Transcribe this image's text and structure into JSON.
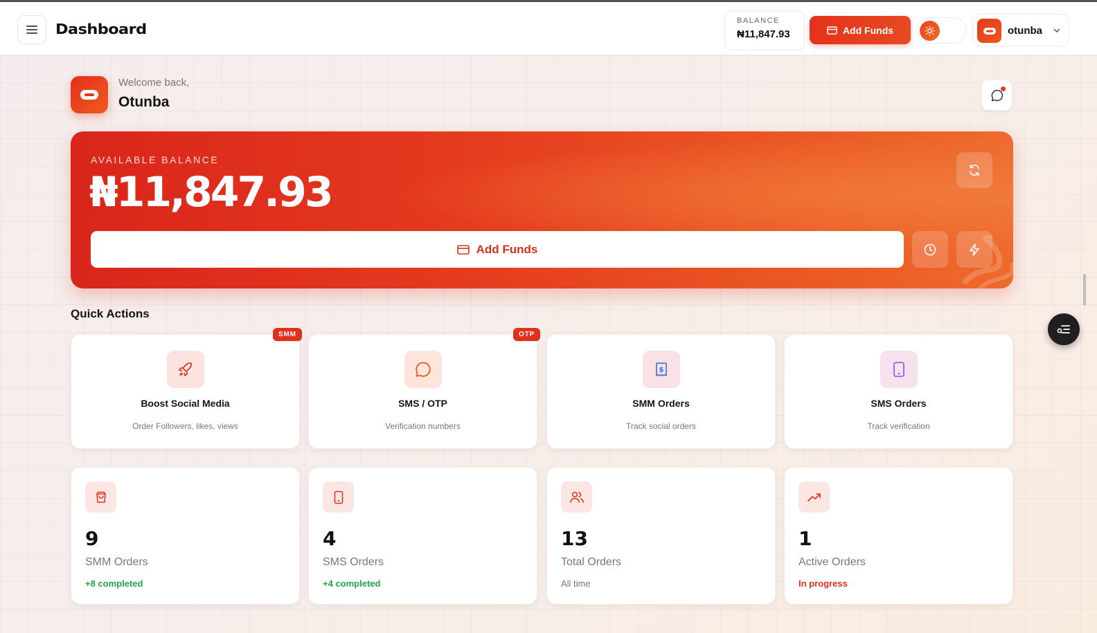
{
  "header": {
    "title": "Dashboard",
    "balance_label": "BALANCE",
    "balance_value": "₦11,847.93",
    "add_funds_label": "Add Funds",
    "username": "otunba"
  },
  "greeting": {
    "subtitle": "Welcome back,",
    "name": "Otunba"
  },
  "balance_card": {
    "label": "AVAILABLE BALANCE",
    "amount": "₦11,847.93",
    "add_funds_label": "Add Funds"
  },
  "quick_actions": {
    "title": "Quick Actions",
    "items": [
      {
        "title": "Boost Social Media",
        "subtitle": "Order Followers, likes, views",
        "badge": "SMM",
        "icon": "rocket-icon",
        "accent": "#e0301b"
      },
      {
        "title": "SMS / OTP",
        "subtitle": "Verification numbers",
        "badge": "OTP",
        "icon": "chat-bubble-icon",
        "accent": "#e8531f"
      },
      {
        "title": "SMM Orders",
        "subtitle": "Track social orders",
        "icon": "receipt-icon",
        "accent": "#2f6fe0"
      },
      {
        "title": "SMS Orders",
        "subtitle": "Track verification",
        "icon": "tablet-icon",
        "accent": "#8a4fd8"
      }
    ]
  },
  "stats": [
    {
      "value": "9",
      "label": "SMM Orders",
      "note": "+8 completed",
      "icon": "shopping-bag-icon"
    },
    {
      "value": "4",
      "label": "SMS Orders",
      "note": "+4 completed",
      "icon": "tablet-icon"
    },
    {
      "value": "13",
      "label": "Total Orders",
      "note": "All time",
      "icon": "users-icon"
    },
    {
      "value": "1",
      "label": "Active Orders",
      "note": "In progress",
      "icon": "trending-up-icon"
    }
  ],
  "colors": {
    "brand": "#e4321c",
    "success": "#1ea64a",
    "icon_tile": "#fbe6e3"
  }
}
